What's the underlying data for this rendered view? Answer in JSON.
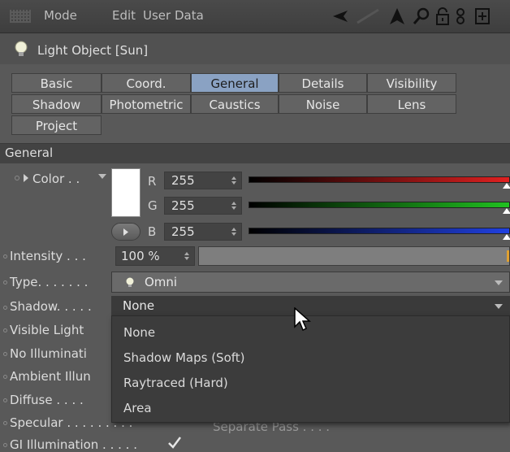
{
  "menubar": {
    "mode": "Mode",
    "edit": "Edit",
    "user_data": "User Data"
  },
  "object": {
    "title": "Light Object [Sun]"
  },
  "tabs": [
    {
      "label": "Basic",
      "active": false
    },
    {
      "label": "Coord.",
      "active": false
    },
    {
      "label": "General",
      "active": true
    },
    {
      "label": "Details",
      "active": false
    },
    {
      "label": "Visibility",
      "active": false
    },
    {
      "label": "Shadow",
      "active": false
    },
    {
      "label": "Photometric",
      "active": false
    },
    {
      "label": "Caustics",
      "active": false
    },
    {
      "label": "Noise",
      "active": false
    },
    {
      "label": "Lens",
      "active": false
    },
    {
      "label": "Project",
      "active": false
    }
  ],
  "section": {
    "title": "General"
  },
  "color": {
    "label": "Color . .",
    "swatch": "#ffffff",
    "r_label": "R",
    "r_value": "255",
    "g_label": "G",
    "g_value": "255",
    "b_label": "B",
    "b_value": "255"
  },
  "intensity": {
    "label": "Intensity . . .",
    "value": "100 %",
    "fraction": 1.0
  },
  "type": {
    "label": "Type. . . . . . .",
    "value": "Omni"
  },
  "shadow": {
    "label": "Shadow. . . . .",
    "value": "None",
    "options": [
      "None",
      "Shadow Maps (Soft)",
      "Raytraced (Hard)",
      "Area"
    ]
  },
  "rows": {
    "visible_light": "Visible Light",
    "no_illumination": "No Illuminati",
    "ambient": "Ambient Illun",
    "diffuse": "Diffuse . . . .",
    "specular": "Specular . . . . . . . . .",
    "separate_pass": "Separate Pass . . . .",
    "gi_illumination": "GI Illumination . . . . ."
  },
  "colors": {
    "active_tab": "#8aa2c3",
    "red": "#e02020",
    "green": "#20c020",
    "blue": "#2040e0"
  }
}
